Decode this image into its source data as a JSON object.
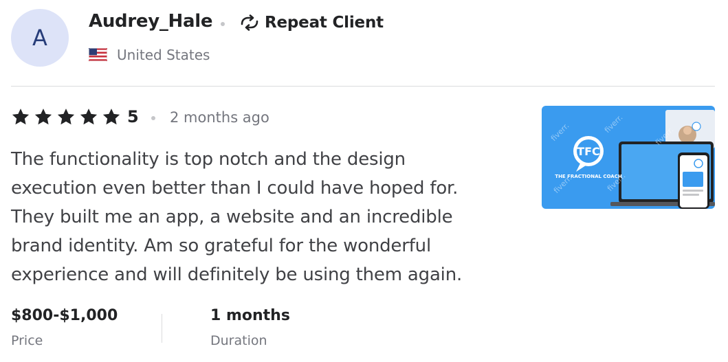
{
  "reviewer": {
    "avatar_initial": "A",
    "username": "Audrey_Hale",
    "badge_label": "Repeat Client",
    "badge_icon": "repeat-icon",
    "flag_icon": "us-flag-icon",
    "country": "United States"
  },
  "review": {
    "stars": 5,
    "rating": "5",
    "time_ago": "2 months ago",
    "text": "The functionality is top notch and the design execution even better than I could have hoped for. They built me an app, a website and an incredible brand identity. Am so grateful for the wonderful experience and will definitely be using them again."
  },
  "thumbnail": {
    "logo_text": "TFC",
    "brand_name": "THE FRACTIONAL COACH",
    "watermark": "fiverr.",
    "bg_color": "#3a9bef"
  },
  "order": {
    "price_value": "$800-$1,000",
    "price_label": "Price",
    "duration_value": "1 months",
    "duration_label": "Duration"
  },
  "colors": {
    "avatar_bg": "#dde3f8",
    "avatar_text": "#273d7a",
    "star": "#222325",
    "muted_text": "#74767e"
  }
}
